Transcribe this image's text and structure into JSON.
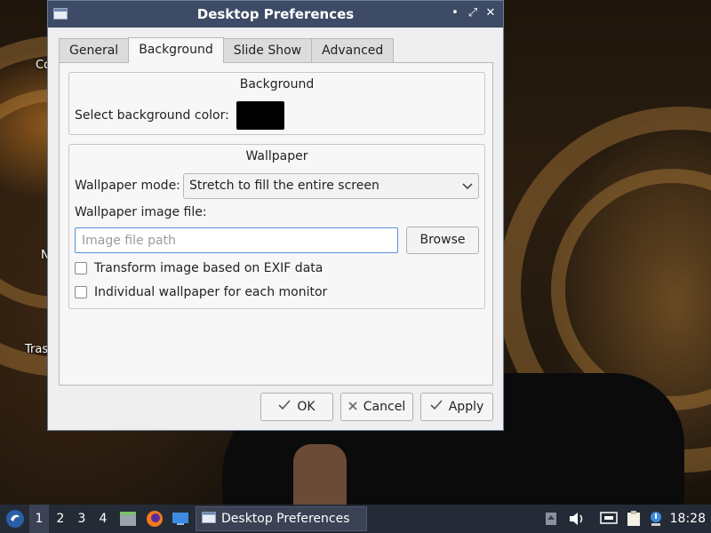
{
  "desktop": {
    "icon_labels": [
      "Co",
      "N",
      "Tras"
    ]
  },
  "window": {
    "title": "Desktop Preferences",
    "controls": {
      "minimize": "•",
      "maximize": "⤢",
      "close": "✕"
    }
  },
  "tabs": [
    {
      "label": "General"
    },
    {
      "label": "Background",
      "active": true
    },
    {
      "label": "Slide Show"
    },
    {
      "label": "Advanced"
    }
  ],
  "background_group": {
    "title": "Background",
    "color_label": "Select background color:",
    "color_value": "#000000"
  },
  "wallpaper_group": {
    "title": "Wallpaper",
    "mode_label": "Wallpaper mode:",
    "mode_value": "Stretch to fill the entire screen",
    "file_label": "Wallpaper image file:",
    "file_value": "",
    "file_placeholder": "Image file path",
    "browse_label": "Browse",
    "exif_label": "Transform image based on EXIF data",
    "exif_checked": false,
    "per_monitor_label": "Individual wallpaper for each monitor",
    "per_monitor_checked": false
  },
  "buttons": {
    "ok": "OK",
    "cancel": "Cancel",
    "apply": "Apply"
  },
  "taskbar": {
    "workspaces": [
      "1",
      "2",
      "3",
      "4"
    ],
    "active_workspace": "1",
    "task_label": "Desktop Preferences",
    "clock": "18:28",
    "bg_color": "#252b36"
  }
}
